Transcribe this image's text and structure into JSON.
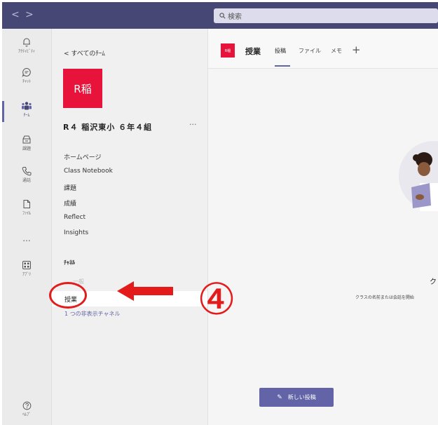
{
  "titlebar": {
    "back": "<",
    "forward": ">",
    "search_placeholder": "検索"
  },
  "rail": {
    "items": [
      {
        "name": "activity",
        "label": "ｱｸﾃｨﾋﾞﾃｨ",
        "icon": "bell-icon"
      },
      {
        "name": "chat",
        "label": "ﾁｬｯﾄ",
        "icon": "chat-icon"
      },
      {
        "name": "teams",
        "label": "ﾁｰﾑ",
        "icon": "teams-icon",
        "active": true
      },
      {
        "name": "assignments",
        "label": "課題",
        "icon": "assignments-icon"
      },
      {
        "name": "calls",
        "label": "通話",
        "icon": "phone-icon"
      },
      {
        "name": "files",
        "label": "ﾌｧｲﾙ",
        "icon": "file-icon"
      },
      {
        "name": "apps",
        "label": "ｱﾌﾟﾘ",
        "icon": "apps-icon"
      }
    ],
    "more": "...",
    "help": "ﾍﾙﾌﾟ"
  },
  "panel": {
    "back_link": "< すべてのﾁｰﾑ",
    "team_tile": "R稲",
    "team_name": "R４ 稲沢東小 ６年４組",
    "more": "···",
    "menu": [
      "ホームページ",
      "Class Notebook",
      "課題",
      "成績",
      "Reflect",
      "Insights"
    ],
    "channels_header": "ﾁｬﾈﾙ",
    "channels": [
      "一般",
      "授業"
    ],
    "hidden_channels": "1 つの非表示チャネル"
  },
  "main": {
    "tile": "R稲",
    "channel_title": "授業",
    "tabs": [
      "投稿",
      "ファイル",
      "メモ"
    ],
    "plus": "+",
    "heading_fragment": "ク",
    "sub_text": "クラスの名前または会話を開始",
    "new_post": "新しい投稿"
  },
  "annotation": {
    "number": "④"
  },
  "colors": {
    "titlebar": "#464775",
    "accent": "#6264a7",
    "team_tile": "#e8133a",
    "annotation": "#e31b1b"
  }
}
